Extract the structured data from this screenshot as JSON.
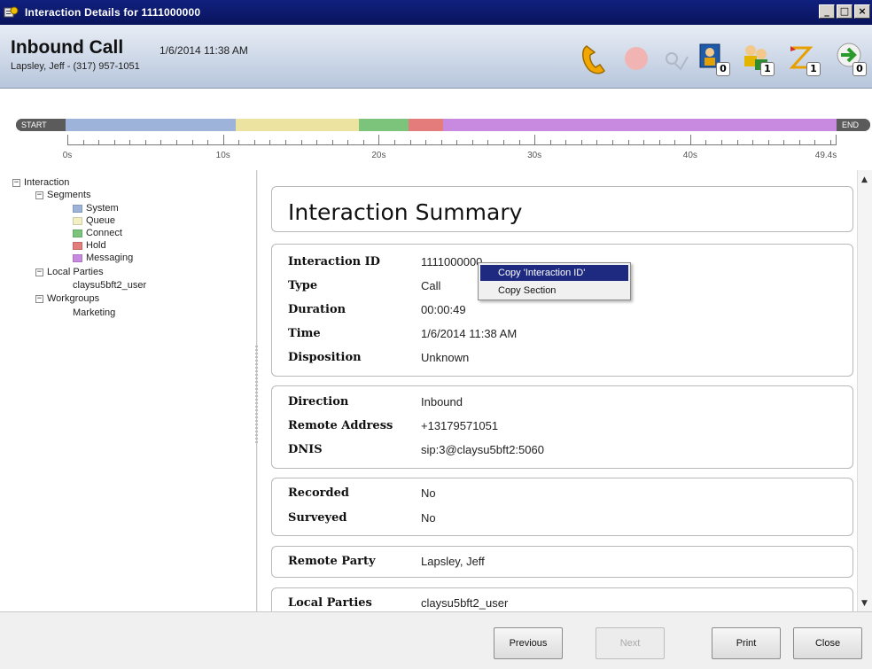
{
  "window": {
    "title": "Interaction Details for 1111000000"
  },
  "header": {
    "call_type": "Inbound Call",
    "date_time": "1/6/2014 11:38 AM",
    "party": "Lapsley, Jeff - (317) 957-1051",
    "icons": [
      {
        "name": "phone-icon"
      },
      {
        "name": "record-icon"
      },
      {
        "name": "survey-icon"
      },
      {
        "name": "attendant-icon",
        "badge": "0"
      },
      {
        "name": "workgroup-icon",
        "badge": "1"
      },
      {
        "name": "transfer-icon",
        "badge": "1"
      },
      {
        "name": "next-arrow-icon",
        "badge": "0"
      }
    ]
  },
  "timeline": {
    "start_label": "START",
    "end_label": "END",
    "segments": [
      {
        "name": "System",
        "start": 0,
        "end": 10.9,
        "color": "#9db3d9"
      },
      {
        "name": "Queue",
        "start": 10.9,
        "end": 18.8,
        "color": "#ece3a0"
      },
      {
        "name": "Connect",
        "start": 18.8,
        "end": 22.0,
        "color": "#7cc47c"
      },
      {
        "name": "Hold",
        "start": 22.0,
        "end": 24.2,
        "color": "#e57c7c"
      },
      {
        "name": "Messaging",
        "start": 24.2,
        "end": 49.4,
        "color": "#c88ae0"
      }
    ],
    "tick_labels": [
      "0s",
      "10s",
      "20s",
      "30s",
      "40s",
      "49.4s"
    ]
  },
  "tree": {
    "root": "Interaction",
    "segments_label": "Segments",
    "segments": [
      {
        "label": "System",
        "color": "#9db3d9"
      },
      {
        "label": "Queue",
        "color": "#f3efc4"
      },
      {
        "label": "Connect",
        "color": "#7cc47c"
      },
      {
        "label": "Hold",
        "color": "#e57c7c"
      },
      {
        "label": "Messaging",
        "color": "#c88ae0"
      }
    ],
    "local_parties_label": "Local Parties",
    "local_parties": [
      "claysu5bft2_user"
    ],
    "workgroups_label": "Workgroups",
    "workgroups": [
      "Marketing"
    ]
  },
  "summary": {
    "title": "Interaction Summary",
    "section1": {
      "interaction_id_label": "Interaction ID",
      "interaction_id": "1111000000",
      "type_label": "Type",
      "type": "Call",
      "duration_label": "Duration",
      "duration": "00:00:49",
      "time_label": "Time",
      "time": "1/6/2014 11:38 AM",
      "disposition_label": "Disposition",
      "disposition": "Unknown"
    },
    "section2": {
      "direction_label": "Direction",
      "direction": "Inbound",
      "remote_address_label": "Remote Address",
      "remote_address": "+13179571051",
      "dnis_label": "DNIS",
      "dnis": "sip:3@claysu5bft2:5060"
    },
    "section3": {
      "recorded_label": "Recorded",
      "recorded": "No",
      "surveyed_label": "Surveyed",
      "surveyed": "No"
    },
    "section4": {
      "remote_party_label": "Remote Party",
      "remote_party": "Lapsley, Jeff"
    },
    "section5": {
      "local_parties_label": "Local Parties",
      "local_parties": "claysu5bft2_user"
    }
  },
  "context_menu": {
    "items": [
      "Copy 'Interaction ID'",
      "Copy Section"
    ]
  },
  "footer": {
    "previous": "Previous",
    "next": "Next",
    "print": "Print",
    "close": "Close"
  }
}
